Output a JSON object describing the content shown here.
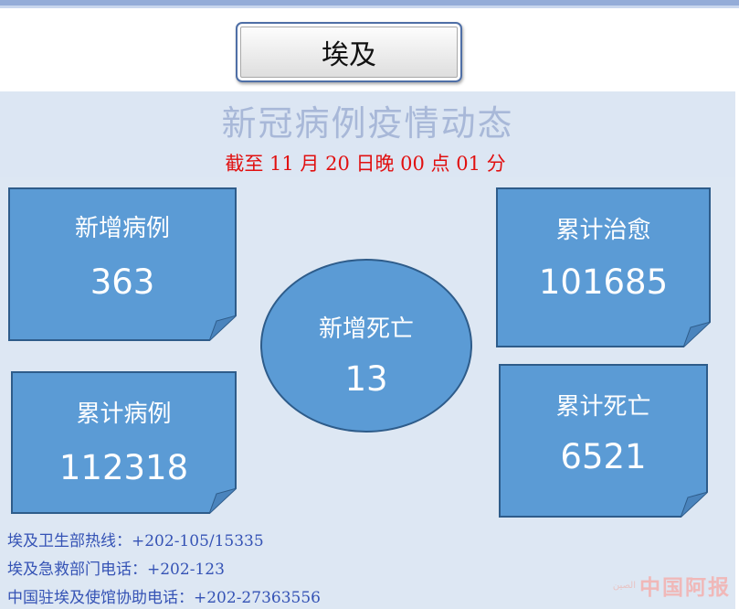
{
  "title": "埃及",
  "header": {
    "main_title": "新冠病例疫情动态",
    "date_line": "截至 11 月 20 日晚 00 点 01 分"
  },
  "cards": {
    "new_cases": {
      "label": "新增病例",
      "value": "363"
    },
    "total_cases": {
      "label": "累计病例",
      "value": "112318"
    },
    "new_deaths": {
      "label": "新增死亡",
      "value": "13"
    },
    "total_recovered": {
      "label": "累计治愈",
      "value": "101685"
    },
    "total_deaths": {
      "label": "累计死亡",
      "value": "6521"
    }
  },
  "contacts": [
    "埃及卫生部热线：+202-105/15335",
    "埃及急救部门电话：+202-123",
    "中国驻埃及使馆协助电话：+202-27363556"
  ],
  "watermark": {
    "text": "中国阿报",
    "small": "الصين"
  },
  "colors": {
    "card_fill": "#5b9bd5",
    "card_border": "#2e5c8a",
    "band": "#dde7f3",
    "date_red": "#e11010",
    "contact_blue": "#3553b5"
  }
}
